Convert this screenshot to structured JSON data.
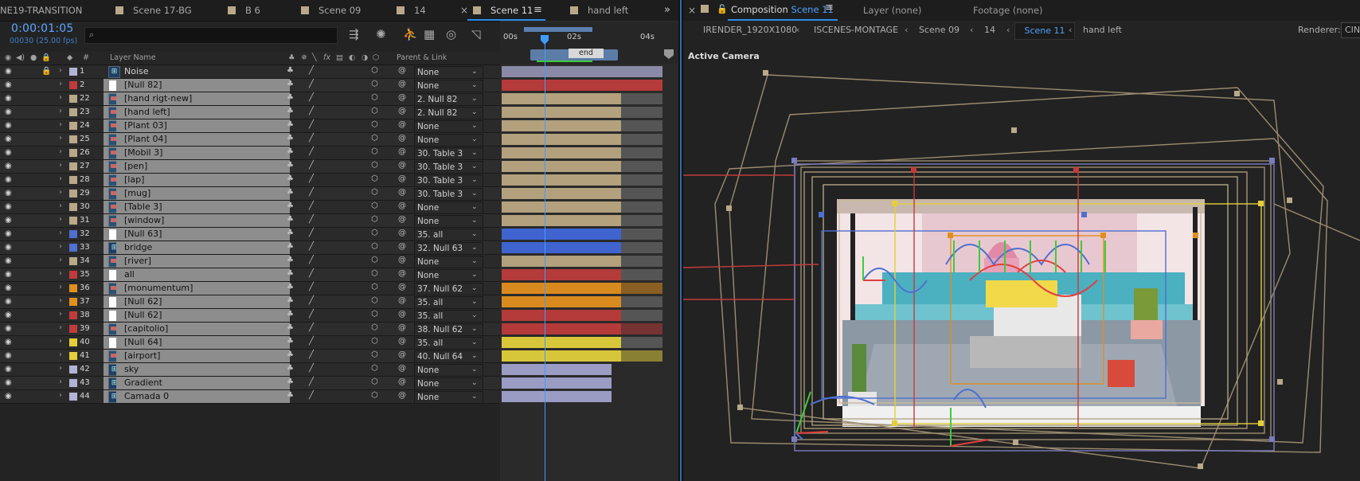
{
  "left_tabs": [
    {
      "label": "NE19-TRANSITION"
    },
    {
      "label": "Scene 17-BG"
    },
    {
      "label": "B 6"
    },
    {
      "label": "Scene 09"
    },
    {
      "label": "14"
    },
    {
      "label": "Scene 11"
    },
    {
      "label": "hand left"
    }
  ],
  "timecode": "0:00:01:05",
  "fps": "00030 (25.00 fps)",
  "search_placeholder": "",
  "columns": {
    "layer_name": "Layer Name",
    "parent": "Parent & Link",
    "hash": "#"
  },
  "timeline": {
    "ruler_labels": [
      "00s",
      "02s",
      "04s"
    ],
    "marker": "end"
  },
  "layers": [
    {
      "num": "1",
      "name": "Noise",
      "type": "pcomp",
      "label": "#b2b4d6",
      "parent": "None",
      "bar": "#8a8aa8",
      "selected": false,
      "lock": true
    },
    {
      "num": "2",
      "name": "[Null 82]",
      "type": "null",
      "label": "#c23b3b",
      "parent": "None",
      "bar": "#b53a3a",
      "selected": true
    },
    {
      "num": "22",
      "name": "[hand rigt-new]",
      "type": "comp",
      "label": "#b9a98a",
      "parent": "2. Null 82",
      "bar": "#b3a07d",
      "selected": true
    },
    {
      "num": "23",
      "name": "[hand left]",
      "type": "comp",
      "label": "#b9a98a",
      "parent": "2. Null 82",
      "bar": "#b3a07d",
      "selected": true
    },
    {
      "num": "24",
      "name": "[Plant 03]",
      "type": "comp",
      "label": "#b9a98a",
      "parent": "None",
      "bar": "#b3a07d",
      "selected": true
    },
    {
      "num": "25",
      "name": "[Plant 04]",
      "type": "comp",
      "label": "#b9a98a",
      "parent": "None",
      "bar": "#b3a07d",
      "selected": true
    },
    {
      "num": "26",
      "name": "[Mobil 3]",
      "type": "comp",
      "label": "#b9a98a",
      "parent": "30. Table 3",
      "bar": "#b3a07d",
      "selected": true
    },
    {
      "num": "27",
      "name": "[pen]",
      "type": "comp",
      "label": "#b9a98a",
      "parent": "30. Table 3",
      "bar": "#b3a07d",
      "selected": true
    },
    {
      "num": "28",
      "name": "[lap]",
      "type": "comp",
      "label": "#b9a98a",
      "parent": "30. Table 3",
      "bar": "#b3a07d",
      "selected": true
    },
    {
      "num": "29",
      "name": "[mug]",
      "type": "comp",
      "label": "#b9a98a",
      "parent": "30. Table 3",
      "bar": "#b3a07d",
      "selected": true
    },
    {
      "num": "30",
      "name": "[Table 3]",
      "type": "comp",
      "label": "#b9a98a",
      "parent": "None",
      "bar": "#b3a07d",
      "selected": true
    },
    {
      "num": "31",
      "name": "[window]",
      "type": "comp",
      "label": "#b9a98a",
      "parent": "None",
      "bar": "#b3a07d",
      "selected": true
    },
    {
      "num": "32",
      "name": "[Null 63]",
      "type": "null",
      "label": "#4f6fd1",
      "parent": "35. all",
      "bar": "#3f64d0",
      "selected": true
    },
    {
      "num": "33",
      "name": "bridge",
      "type": "pcomp",
      "label": "#4f6fd1",
      "parent": "32. Null 63",
      "bar": "#3f64d0",
      "selected": true
    },
    {
      "num": "34",
      "name": "[river]",
      "type": "comp",
      "label": "#b9a98a",
      "parent": "None",
      "bar": "#b3a07d",
      "selected": true
    },
    {
      "num": "35",
      "name": "all",
      "type": "null",
      "label": "#c23b3b",
      "parent": "None",
      "bar": "#b53a3a",
      "selected": true
    },
    {
      "num": "36",
      "name": "[monumentum]",
      "type": "comp",
      "label": "#e08f1e",
      "parent": "37. Null 62",
      "bar": "#d98a1e",
      "selected": true
    },
    {
      "num": "37",
      "name": "[Null 62]",
      "type": "null",
      "label": "#e08f1e",
      "parent": "35. all",
      "bar": "#d98a1e",
      "selected": true
    },
    {
      "num": "38",
      "name": "[Null 62]",
      "type": "null",
      "label": "#c23b3b",
      "parent": "35. all",
      "bar": "#b53a3a",
      "selected": true
    },
    {
      "num": "39",
      "name": "[capitolio]",
      "type": "comp",
      "label": "#c23b3b",
      "parent": "38. Null 62",
      "bar": "#b53a3a",
      "selected": true
    },
    {
      "num": "40",
      "name": "[Null 64]",
      "type": "null",
      "label": "#e3cf3a",
      "parent": "35. all",
      "bar": "#d8c63a",
      "selected": true
    },
    {
      "num": "41",
      "name": "[airport]",
      "type": "comp",
      "label": "#e3cf3a",
      "parent": "40. Null 64",
      "bar": "#d8c63a",
      "selected": true
    },
    {
      "num": "42",
      "name": "sky",
      "type": "pcomp",
      "label": "#b2b4d6",
      "parent": "None",
      "bar": "#9a9cc4",
      "selected": true
    },
    {
      "num": "43",
      "name": "Gradient",
      "type": "pcomp",
      "label": "#b2b4d6",
      "parent": "None",
      "bar": "#9a9cc4",
      "selected": true
    },
    {
      "num": "44",
      "name": "Camada 0",
      "type": "pcomp",
      "label": "#b2b4d6",
      "parent": "None",
      "bar": "#9a9cc4",
      "selected": true
    }
  ],
  "right_tabs": {
    "composition_prefix": "Composition",
    "composition_name": "Scene 11",
    "layer": "Layer (none)",
    "footage": "Footage (none)"
  },
  "breadcrumbs": [
    "IRENDER_1920X1080",
    "ISCENES-MONTAGE",
    "Scene 09",
    "14",
    "Scene 11",
    "hand left"
  ],
  "renderer_label": "Renderer:",
  "renderer_value": "CIN",
  "viewer_label": "Active Camera",
  "colors": {
    "accent": "#2d8ceb",
    "timecode": "#5ba6ff",
    "tan": "#b9a98a",
    "red": "#c23b3b",
    "blue": "#4f6fd1",
    "orange": "#e08f1e",
    "yellow": "#e3cf3a",
    "lavender": "#b2b4d6"
  }
}
